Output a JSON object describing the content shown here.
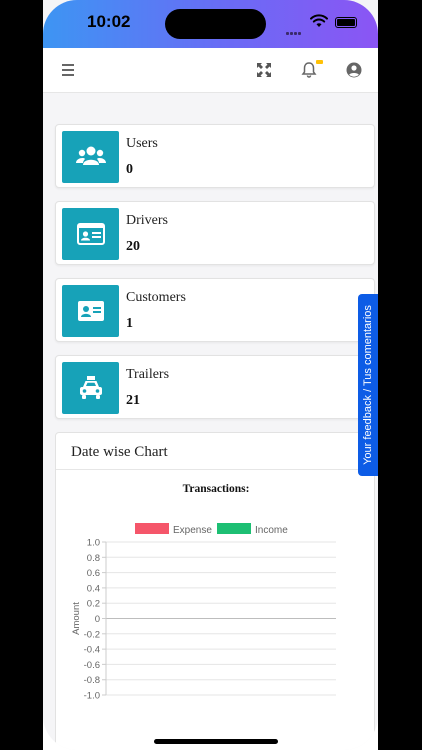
{
  "status_bar": {
    "time": "10:02"
  },
  "nav": {
    "menu_icon": "hamburger-menu-icon",
    "fullscreen_icon": "fullscreen-icon",
    "notification_icon": "bell-icon",
    "profile_icon": "user-circle-icon",
    "badge_color": "#ffc107"
  },
  "cards": [
    {
      "label": "Users",
      "value": "0",
      "icon": "users-icon"
    },
    {
      "label": "Drivers",
      "value": "20",
      "icon": "id-card-icon"
    },
    {
      "label": "Customers",
      "value": "1",
      "icon": "address-card-icon"
    },
    {
      "label": "Trailers",
      "value": "21",
      "icon": "taxi-icon"
    }
  ],
  "chart_section": {
    "title": "Date wise Chart"
  },
  "feedback_tab": {
    "label": "Your feedback / Tus comentarios"
  },
  "colors": {
    "accent": "#17a2b8",
    "feedback": "#0d5ce6",
    "expense": "#f5566a",
    "income": "#1dbf73"
  },
  "chart_data": {
    "type": "bar",
    "title": "Transactions:",
    "xlabel": "",
    "ylabel": "Amount",
    "ylim": [
      -1.0,
      1.0
    ],
    "yticks": [
      "1.0",
      "0.8",
      "0.6",
      "0.4",
      "0.2",
      "0",
      "-0.2",
      "-0.4",
      "-0.6",
      "-0.8",
      "-1.0"
    ],
    "categories": [],
    "series": [
      {
        "name": "Expense",
        "color": "#f5566a",
        "values": []
      },
      {
        "name": "Income",
        "color": "#1dbf73",
        "values": []
      }
    ],
    "grid": true,
    "legend": "top"
  }
}
